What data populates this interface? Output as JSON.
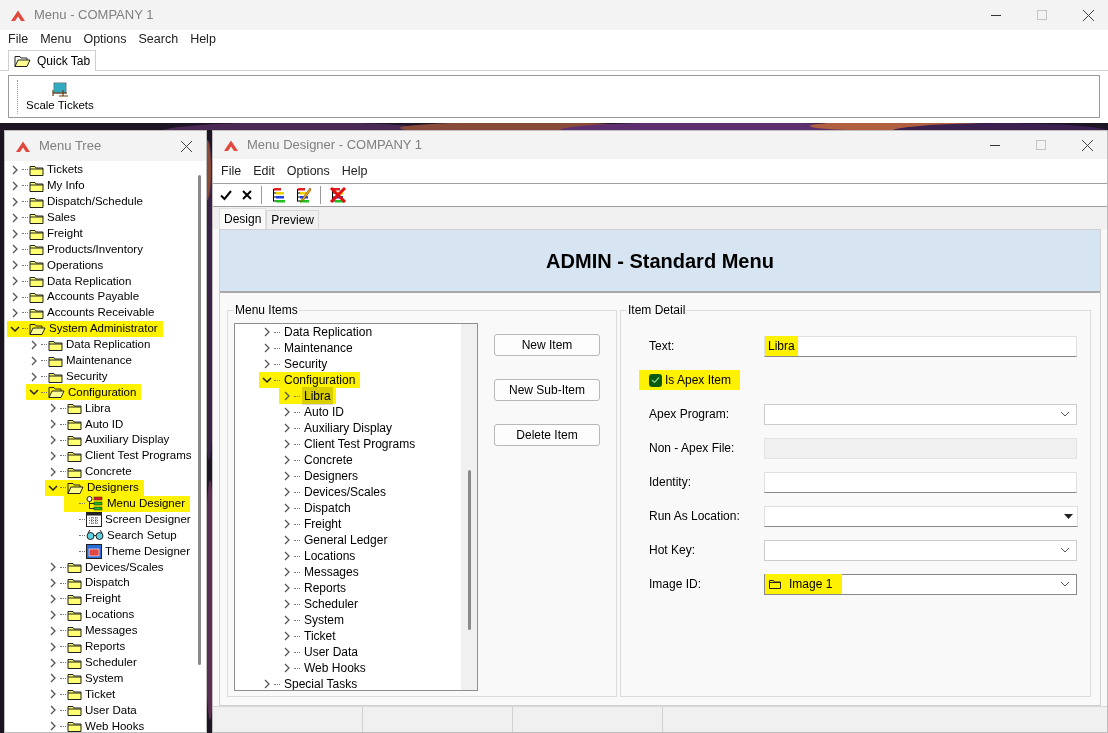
{
  "main_window": {
    "title": "Menu - COMPANY 1",
    "menu": [
      "File",
      "Menu",
      "Options",
      "Search",
      "Help"
    ],
    "tabs": [
      {
        "label": "Quick Tab",
        "selected": true
      }
    ],
    "toolbar_buttons": [
      {
        "label": "Scale Tickets"
      }
    ]
  },
  "menu_tree_window": {
    "title": "Menu Tree",
    "items": [
      {
        "label": "Tickets",
        "kind": "folder",
        "expanded": false,
        "highlighted": false
      },
      {
        "label": "My Info",
        "kind": "folder",
        "expanded": false,
        "highlighted": false
      },
      {
        "label": "Dispatch/Schedule",
        "kind": "folder",
        "expanded": false,
        "highlighted": false
      },
      {
        "label": "Sales",
        "kind": "folder",
        "expanded": false,
        "highlighted": false
      },
      {
        "label": "Freight",
        "kind": "folder",
        "expanded": false,
        "highlighted": false
      },
      {
        "label": "Products/Inventory",
        "kind": "folder",
        "expanded": false,
        "highlighted": false
      },
      {
        "label": "Operations",
        "kind": "folder",
        "expanded": false,
        "highlighted": false
      },
      {
        "label": "Data Replication",
        "kind": "folder",
        "expanded": false,
        "highlighted": false
      },
      {
        "label": "Accounts Payable",
        "kind": "folder",
        "expanded": false,
        "highlighted": false
      },
      {
        "label": "Accounts Receivable",
        "kind": "folder",
        "expanded": false,
        "highlighted": false
      },
      {
        "label": "System Administrator",
        "kind": "folder",
        "expanded": true,
        "highlighted": true,
        "children": [
          {
            "label": "Data Replication",
            "kind": "folder",
            "expanded": false,
            "highlighted": false
          },
          {
            "label": "Maintenance",
            "kind": "folder",
            "expanded": false,
            "highlighted": false
          },
          {
            "label": "Security",
            "kind": "folder",
            "expanded": false,
            "highlighted": false
          },
          {
            "label": "Configuration",
            "kind": "folder",
            "expanded": true,
            "highlighted": true,
            "children": [
              {
                "label": "Libra",
                "kind": "folder",
                "expanded": false,
                "highlighted": false
              },
              {
                "label": "Auto ID",
                "kind": "folder",
                "expanded": false,
                "highlighted": false
              },
              {
                "label": "Auxiliary Display",
                "kind": "folder",
                "expanded": false,
                "highlighted": false
              },
              {
                "label": "Client Test Programs",
                "kind": "folder",
                "expanded": false,
                "highlighted": false
              },
              {
                "label": "Concrete",
                "kind": "folder",
                "expanded": false,
                "highlighted": false
              },
              {
                "label": "Designers",
                "kind": "folder",
                "expanded": true,
                "highlighted": true,
                "children": [
                  {
                    "label": "Menu Designer",
                    "kind": "menu_designer",
                    "highlighted": true
                  },
                  {
                    "label": "Screen Designer",
                    "kind": "screen_designer",
                    "highlighted": false
                  },
                  {
                    "label": "Search Setup",
                    "kind": "search_setup",
                    "highlighted": false
                  },
                  {
                    "label": "Theme Designer",
                    "kind": "theme_designer",
                    "highlighted": false
                  }
                ]
              },
              {
                "label": "Devices/Scales",
                "kind": "folder",
                "expanded": false,
                "highlighted": false
              },
              {
                "label": "Dispatch",
                "kind": "folder",
                "expanded": false,
                "highlighted": false
              },
              {
                "label": "Freight",
                "kind": "folder",
                "expanded": false,
                "highlighted": false
              },
              {
                "label": "Locations",
                "kind": "folder",
                "expanded": false,
                "highlighted": false
              },
              {
                "label": "Messages",
                "kind": "folder",
                "expanded": false,
                "highlighted": false
              },
              {
                "label": "Reports",
                "kind": "folder",
                "expanded": false,
                "highlighted": false
              },
              {
                "label": "Scheduler",
                "kind": "folder",
                "expanded": false,
                "highlighted": false
              },
              {
                "label": "System",
                "kind": "folder",
                "expanded": false,
                "highlighted": false
              },
              {
                "label": "Ticket",
                "kind": "folder",
                "expanded": false,
                "highlighted": false
              },
              {
                "label": "User Data",
                "kind": "folder",
                "expanded": false,
                "highlighted": false
              },
              {
                "label": "Web Hooks",
                "kind": "folder",
                "expanded": false,
                "highlighted": false
              }
            ]
          }
        ]
      }
    ]
  },
  "designer_window": {
    "title": "Menu Designer - COMPANY 1",
    "menu": [
      "File",
      "Edit",
      "Options",
      "Help"
    ],
    "tabs": [
      {
        "label": "Design",
        "selected": true
      },
      {
        "label": "Preview",
        "selected": false
      }
    ],
    "header": "ADMIN - Standard Menu",
    "menu_items": {
      "title": "Menu Items",
      "items": [
        {
          "label": "Data Replication",
          "expanded": false,
          "highlighted": false,
          "selected": false
        },
        {
          "label": "Maintenance",
          "expanded": false,
          "highlighted": false,
          "selected": false
        },
        {
          "label": "Security",
          "expanded": false,
          "highlighted": false,
          "selected": false
        },
        {
          "label": "Configuration",
          "expanded": true,
          "highlighted": true,
          "selected": false,
          "children": [
            {
              "label": "Libra",
              "expanded": false,
              "highlighted": true,
              "selected": true
            },
            {
              "label": "Auto ID",
              "expanded": false,
              "highlighted": false,
              "selected": false
            },
            {
              "label": "Auxiliary Display",
              "expanded": false,
              "highlighted": false,
              "selected": false
            },
            {
              "label": "Client Test Programs",
              "expanded": false,
              "highlighted": false,
              "selected": false
            },
            {
              "label": "Concrete",
              "expanded": false,
              "highlighted": false,
              "selected": false
            },
            {
              "label": "Designers",
              "expanded": false,
              "highlighted": false,
              "selected": false
            },
            {
              "label": "Devices/Scales",
              "expanded": false,
              "highlighted": false,
              "selected": false
            },
            {
              "label": "Dispatch",
              "expanded": false,
              "highlighted": false,
              "selected": false
            },
            {
              "label": "Freight",
              "expanded": false,
              "highlighted": false,
              "selected": false
            },
            {
              "label": "General Ledger",
              "expanded": false,
              "highlighted": false,
              "selected": false
            },
            {
              "label": "Locations",
              "expanded": false,
              "highlighted": false,
              "selected": false
            },
            {
              "label": "Messages",
              "expanded": false,
              "highlighted": false,
              "selected": false
            },
            {
              "label": "Reports",
              "expanded": false,
              "highlighted": false,
              "selected": false
            },
            {
              "label": "Scheduler",
              "expanded": false,
              "highlighted": false,
              "selected": false
            },
            {
              "label": "System",
              "expanded": false,
              "highlighted": false,
              "selected": false
            },
            {
              "label": "Ticket",
              "expanded": false,
              "highlighted": false,
              "selected": false
            },
            {
              "label": "User Data",
              "expanded": false,
              "highlighted": false,
              "selected": false
            },
            {
              "label": "Web Hooks",
              "expanded": false,
              "highlighted": false,
              "selected": false
            }
          ]
        },
        {
          "label": "Special Tasks",
          "expanded": false,
          "highlighted": false,
          "selected": false
        }
      ]
    },
    "buttons": [
      "New Item",
      "New Sub-Item",
      "Delete Item"
    ],
    "item_detail": {
      "title": "Item Detail",
      "fields": [
        {
          "kind": "text",
          "label": "Text:",
          "value": "Libra",
          "highlighted": true,
          "disabled": false
        },
        {
          "kind": "checkbox",
          "label": "Is Apex Item",
          "checked": true,
          "highlighted": true
        },
        {
          "kind": "combo",
          "label": "Apex Program:"
        },
        {
          "kind": "text",
          "label": "Non - Apex File:",
          "disabled": true
        },
        {
          "kind": "text",
          "label": "Identity:",
          "disabled": false
        },
        {
          "kind": "dropdown",
          "label": "Run As Location:"
        },
        {
          "kind": "combo",
          "label": "Hot Key:"
        },
        {
          "kind": "image_combo",
          "label": "Image ID:",
          "value": "Image 1",
          "highlighted": true
        }
      ]
    }
  }
}
